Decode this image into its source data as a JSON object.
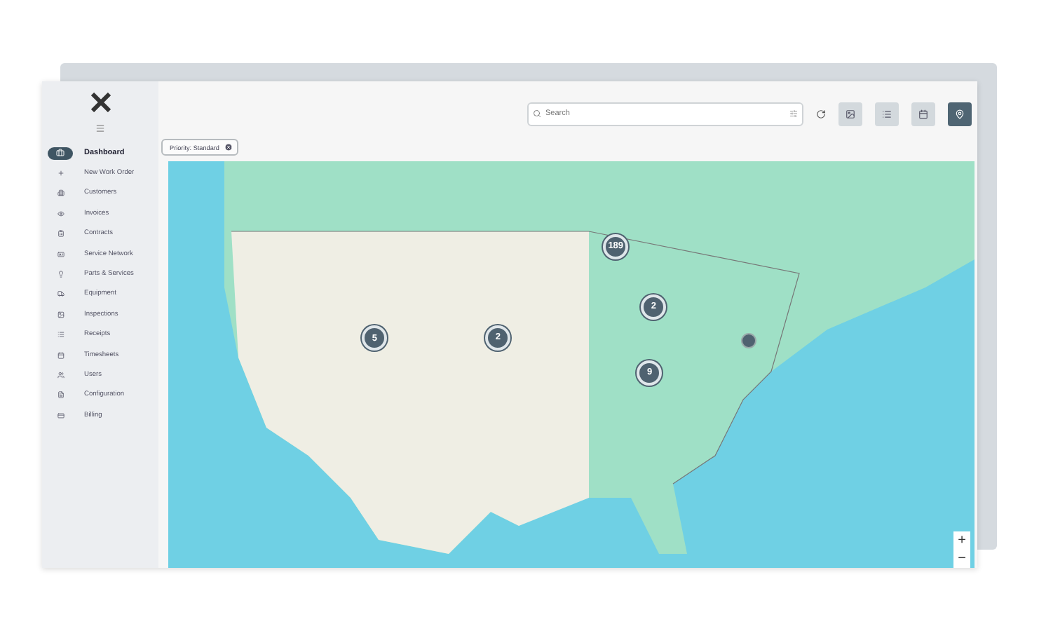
{
  "sidebar": {
    "items": [
      {
        "label": "Dashboard",
        "selected": true
      },
      {
        "label": "New Work Order",
        "selected": false
      },
      {
        "label": "Customers",
        "selected": false
      },
      {
        "label": "Invoices",
        "selected": false
      },
      {
        "label": "Contracts",
        "selected": false
      },
      {
        "label": "Service Network",
        "selected": false
      },
      {
        "label": "Parts & Services",
        "selected": false
      },
      {
        "label": "Equipment",
        "selected": false
      },
      {
        "label": "Inspections",
        "selected": false
      },
      {
        "label": "Receipts",
        "selected": false
      },
      {
        "label": "Timesheets",
        "selected": false
      },
      {
        "label": "Users",
        "selected": false
      },
      {
        "label": "Configuration",
        "selected": false
      },
      {
        "label": "Billing",
        "selected": false
      }
    ]
  },
  "search": {
    "placeholder": "Search"
  },
  "views": [
    {
      "selected": false
    },
    {
      "selected": false
    },
    {
      "selected": false
    },
    {
      "selected": true
    }
  ],
  "filter_chip": {
    "label": "Priority: Standard"
  },
  "map": {
    "clusters": [
      {
        "count": "189"
      },
      {
        "count": "2"
      },
      {
        "count": "5"
      },
      {
        "count": "2"
      },
      {
        "count": "9"
      }
    ],
    "zoom_in": "+",
    "zoom_out": "−"
  }
}
